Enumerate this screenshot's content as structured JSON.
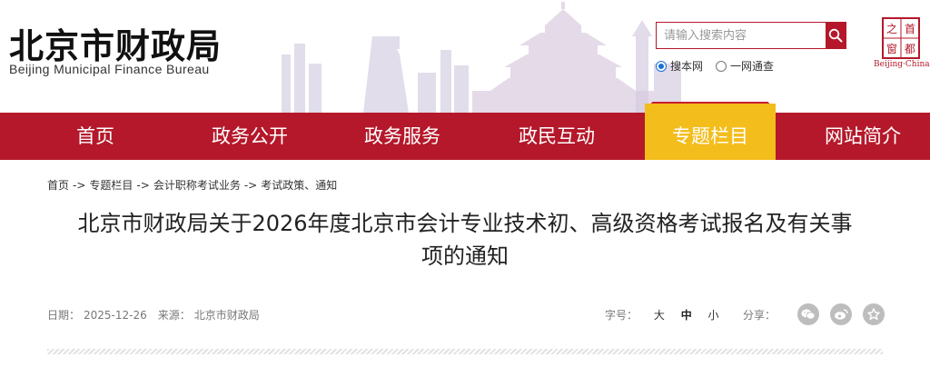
{
  "header": {
    "title": "北京市财政局",
    "subtitle": "Beijing Municipal Finance Bureau",
    "seal_caption": "Beijing·China"
  },
  "search": {
    "placeholder": "请输入搜索内容",
    "options": [
      "搜本网",
      "一网通查"
    ],
    "selected": "搜本网"
  },
  "nav": {
    "items": [
      "首页",
      "政务公开",
      "政务服务",
      "政民互动",
      "专题栏目",
      "网站简介"
    ],
    "active": "专题栏目"
  },
  "breadcrumb": {
    "items": [
      "首页",
      "专题栏目",
      "会计职称考试业务",
      "考试政策、通知"
    ],
    "separator": "->"
  },
  "article": {
    "title_line1": "北京市财政局关于2026年度北京市会计专业技术初、高级资格考试报名及有关事",
    "title_line2": "项的通知",
    "date_label": "日期：",
    "date": "2025-12-26",
    "source_label": "来源：",
    "source": "北京市财政局",
    "font_size_label": "字号：",
    "font_sizes": [
      "大",
      "中",
      "小"
    ],
    "share_label": "分享："
  },
  "colors": {
    "brand_red": "#b4182a",
    "nav_active": "#f3bd1c",
    "radio_blue": "#1a6fd6"
  },
  "icons": {
    "search": "search-icon",
    "share": [
      "wechat-icon",
      "weibo-icon",
      "favorite-star-icon"
    ]
  }
}
